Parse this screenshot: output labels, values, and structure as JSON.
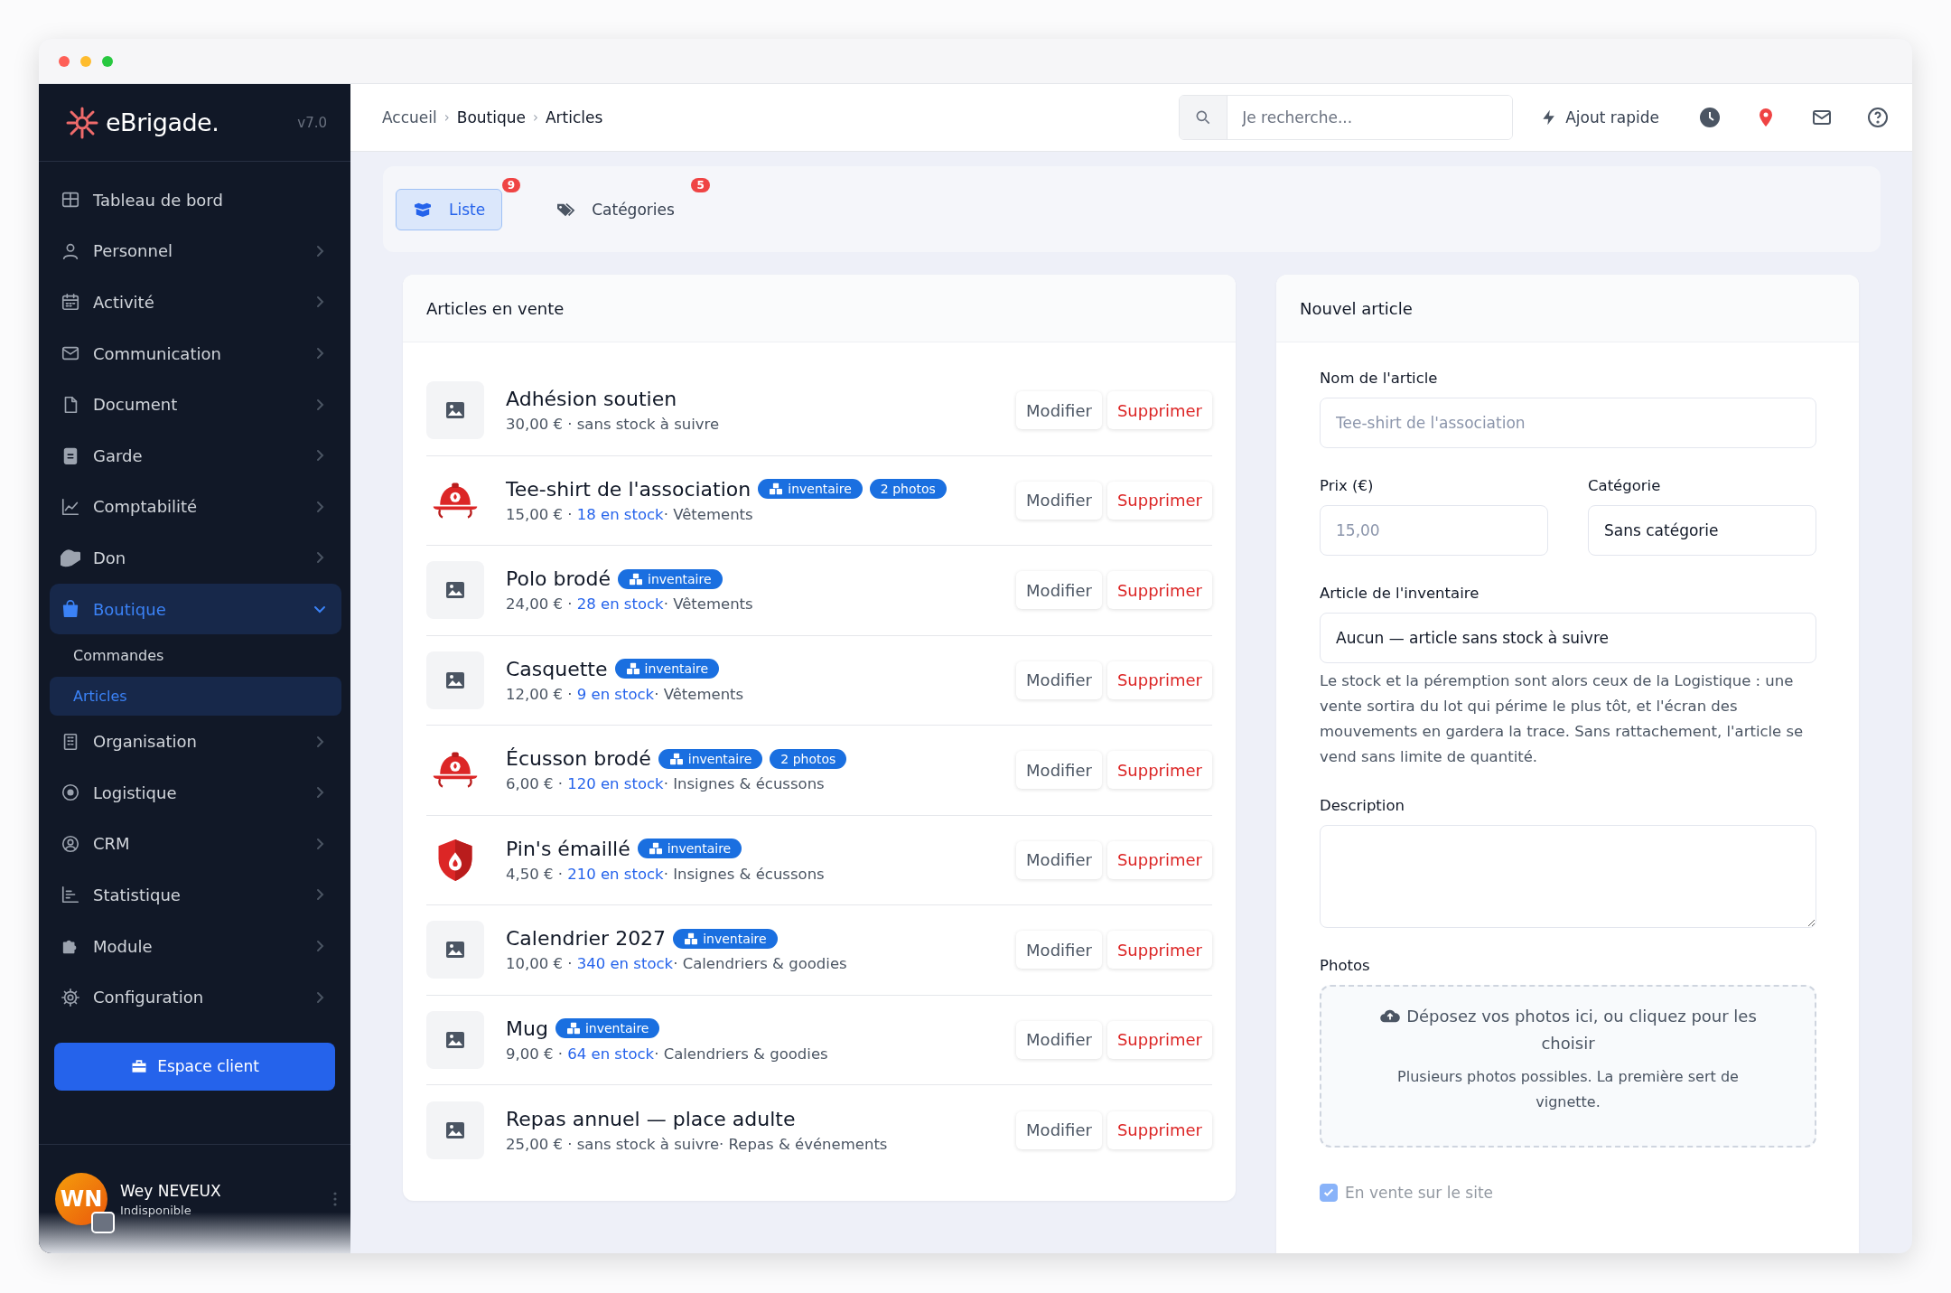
{
  "brand": {
    "name": "eBrigade.",
    "version": "v7.0"
  },
  "sidebar": {
    "items": [
      {
        "label": "Tableau de bord",
        "selected": false
      },
      {
        "label": "Personnel",
        "selected": false,
        "expanded": false
      },
      {
        "label": "Activité",
        "selected": false,
        "expanded": false
      },
      {
        "label": "Communication",
        "selected": false,
        "expanded": false
      },
      {
        "label": "Document",
        "selected": false,
        "expanded": false
      },
      {
        "label": "Garde",
        "selected": false,
        "expanded": false
      },
      {
        "label": "Comptabilité",
        "selected": false,
        "expanded": false
      },
      {
        "label": "Don",
        "selected": false,
        "expanded": false
      },
      {
        "label": "Boutique",
        "selected": true,
        "expanded": true,
        "children": [
          {
            "label": "Commandes",
            "selected": false
          },
          {
            "label": "Articles",
            "selected": true
          }
        ]
      },
      {
        "label": "Organisation",
        "selected": false,
        "expanded": false
      },
      {
        "label": "Logistique",
        "selected": false,
        "expanded": false
      },
      {
        "label": "CRM",
        "selected": false,
        "expanded": false
      },
      {
        "label": "Statistique",
        "selected": false,
        "expanded": false
      },
      {
        "label": "Module",
        "selected": false,
        "expanded": false
      },
      {
        "label": "Configuration",
        "selected": false,
        "expanded": false
      }
    ],
    "client_button": "Espace client",
    "user": {
      "initials": "WN",
      "name": "Wey NEVEUX",
      "status": "Indisponible"
    }
  },
  "topbar": {
    "breadcrumbs": [
      "Accueil",
      "Boutique",
      "Articles"
    ],
    "breadcrumb_separator": "›",
    "search": {
      "placeholder": "Je recherche..."
    },
    "quick_add": "Ajout rapide"
  },
  "tabs": [
    {
      "label": "Liste",
      "count": "9",
      "selected": true
    },
    {
      "label": "Catégories",
      "count": "5",
      "selected": false
    }
  ],
  "list": {
    "title": "Articles en vente",
    "separator": "·",
    "items": [
      {
        "name": "Adhésion soutien",
        "price": "30,00 €",
        "stock": "sans stock à suivre",
        "tracked": false,
        "actions": [
          {
            "kind": "edit",
            "label": "Modifier"
          },
          {
            "kind": "delete",
            "label": "Supprimer"
          }
        ]
      },
      {
        "name": "Tee-shirt de l'association",
        "badges": [
          {
            "kind": "inventory",
            "label": "inventaire"
          },
          {
            "kind": "photos",
            "label": "2 photos"
          }
        ],
        "price": "15,00 €",
        "stock": "18 en stock",
        "tracked": true,
        "category": "Vêtements",
        "actions": [
          {
            "kind": "edit",
            "label": "Modifier"
          },
          {
            "kind": "delete",
            "label": "Supprimer"
          }
        ]
      },
      {
        "name": "Polo brodé",
        "badges": [
          {
            "kind": "inventory",
            "label": "inventaire"
          }
        ],
        "price": "24,00 €",
        "stock": "28 en stock",
        "tracked": true,
        "category": "Vêtements",
        "actions": [
          {
            "kind": "edit",
            "label": "Modifier"
          },
          {
            "kind": "delete",
            "label": "Supprimer"
          }
        ]
      },
      {
        "name": "Casquette",
        "badges": [
          {
            "kind": "inventory",
            "label": "inventaire"
          }
        ],
        "price": "12,00 €",
        "stock": "9 en stock",
        "tracked": true,
        "category": "Vêtements",
        "actions": [
          {
            "kind": "edit",
            "label": "Modifier"
          },
          {
            "kind": "delete",
            "label": "Supprimer"
          }
        ]
      },
      {
        "name": "Écusson brodé",
        "badges": [
          {
            "kind": "inventory",
            "label": "inventaire"
          },
          {
            "kind": "photos",
            "label": "2 photos"
          }
        ],
        "price": "6,00 €",
        "stock": "120 en stock",
        "tracked": true,
        "category": "Insignes & écussons",
        "actions": [
          {
            "kind": "edit",
            "label": "Modifier"
          },
          {
            "kind": "delete",
            "label": "Supprimer"
          }
        ]
      },
      {
        "name": "Pin's émaillé",
        "badges": [
          {
            "kind": "inventory",
            "label": "inventaire"
          }
        ],
        "price": "4,50 €",
        "stock": "210 en stock",
        "tracked": true,
        "category": "Insignes & écussons",
        "actions": [
          {
            "kind": "edit",
            "label": "Modifier"
          },
          {
            "kind": "delete",
            "label": "Supprimer"
          }
        ]
      },
      {
        "name": "Calendrier 2027",
        "badges": [
          {
            "kind": "inventory",
            "label": "inventaire"
          }
        ],
        "price": "10,00 €",
        "stock": "340 en stock",
        "tracked": true,
        "category": "Calendriers & goodies",
        "actions": [
          {
            "kind": "edit",
            "label": "Modifier"
          },
          {
            "kind": "delete",
            "label": "Supprimer"
          }
        ]
      },
      {
        "name": "Mug",
        "badges": [
          {
            "kind": "inventory",
            "label": "inventaire"
          }
        ],
        "price": "9,00 €",
        "stock": "64 en stock",
        "tracked": true,
        "category": "Calendriers & goodies",
        "actions": [
          {
            "kind": "edit",
            "label": "Modifier"
          },
          {
            "kind": "delete",
            "label": "Supprimer"
          }
        ]
      },
      {
        "name": "Repas annuel — place adulte",
        "price": "25,00 €",
        "stock": "sans stock à suivre",
        "tracked": false,
        "category": "Repas & événements",
        "actions": [
          {
            "kind": "edit",
            "label": "Modifier"
          },
          {
            "kind": "delete",
            "label": "Supprimer"
          }
        ]
      }
    ]
  },
  "form": {
    "title": "Nouvel article",
    "name_field": {
      "label": "Nom de l'article",
      "placeholder": "Tee-shirt de l'association"
    },
    "price_field": {
      "label": "Prix (€)",
      "placeholder": "15,00"
    },
    "category_field": {
      "label": "Catégorie",
      "value": "Sans catégorie"
    },
    "inventory_field": {
      "label": "Article de l'inventaire",
      "value": "Aucun — article sans stock à suivre"
    },
    "inventory_help": "Le stock et la péremption sont alors ceux de la Logistique : une vente sortira du lot qui périme le plus tôt, et l'écran des mouvements en gardera la trace. Sans rattachement, l'article se vend sans limite de quantité.",
    "description_field": {
      "label": "Description"
    },
    "photos": {
      "label": "Photos",
      "drop_text": "Déposez vos photos ici, ou cliquez pour les choisir",
      "hint": "Plusieurs photos possibles. La première sert de vignette."
    },
    "on_sale": {
      "label": "En vente sur le site",
      "checked": true
    }
  }
}
